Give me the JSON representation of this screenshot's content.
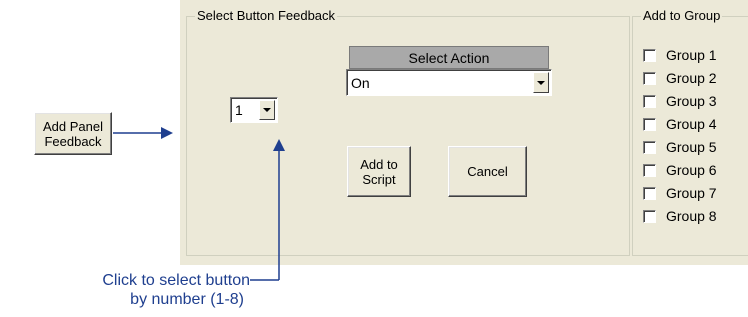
{
  "left_button": {
    "label_line1": "Add Panel",
    "label_line2": "Feedback"
  },
  "select_feedback": {
    "title": "Select Button Feedback",
    "button_number": "1",
    "action_header": "Select Action",
    "action_value": "On",
    "add_script_line1": "Add to",
    "add_script_line2": "Script",
    "cancel_label": "Cancel"
  },
  "add_to_group": {
    "title": "Add to Group",
    "groups": [
      "Group 1",
      "Group 2",
      "Group 3",
      "Group 4",
      "Group 5",
      "Group 6",
      "Group 7",
      "Group 8"
    ],
    "checked": [
      false,
      false,
      false,
      false,
      false,
      false,
      false,
      false
    ]
  },
  "callout": {
    "line1": "Click to select button",
    "line2": "by number (1-8)"
  },
  "colors": {
    "panel_bg": "#ece9d8",
    "header_bar": "#a9a9a9",
    "callout_blue": "#1f3f8f"
  }
}
